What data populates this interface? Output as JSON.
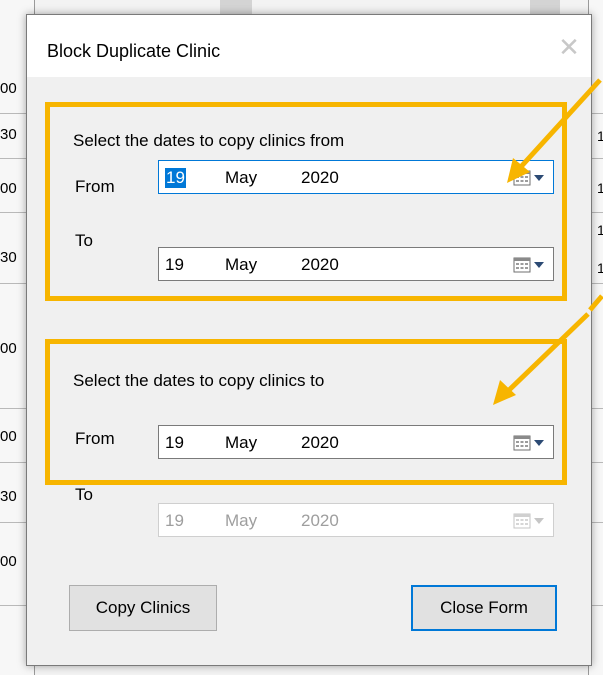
{
  "background": {
    "time_labels": [
      "00",
      "30",
      "00",
      "30",
      "00",
      "00",
      "30",
      "00"
    ],
    "right_marks": [
      "1",
      "1",
      "1",
      "1"
    ]
  },
  "dialog": {
    "title": "Block Duplicate Clinic",
    "close_glyph": "✕",
    "copy_from_section": {
      "prompt": "Select the dates to copy clinics from",
      "from_label": "From",
      "from_date": {
        "day": "19",
        "month": "May",
        "year": "2020"
      },
      "to_label": "To",
      "to_date": {
        "day": "19",
        "month": "May",
        "year": "2020"
      }
    },
    "copy_to_section": {
      "prompt": "Select the dates to copy clinics to",
      "from_label": "From",
      "from_date": {
        "day": "19",
        "month": "May",
        "year": "2020"
      },
      "to_label": "To",
      "to_date": {
        "day": "19",
        "month": "May",
        "year": "2020"
      }
    },
    "copy_button": "Copy Clinics",
    "close_button": "Close Form"
  },
  "colors": {
    "highlight": "#f7b500",
    "focus_blue": "#0078d7",
    "dialog_bg": "#f0f0f0"
  },
  "icons": [
    "calendar-dropdown-icon",
    "close-icon",
    "annotation-arrow"
  ]
}
